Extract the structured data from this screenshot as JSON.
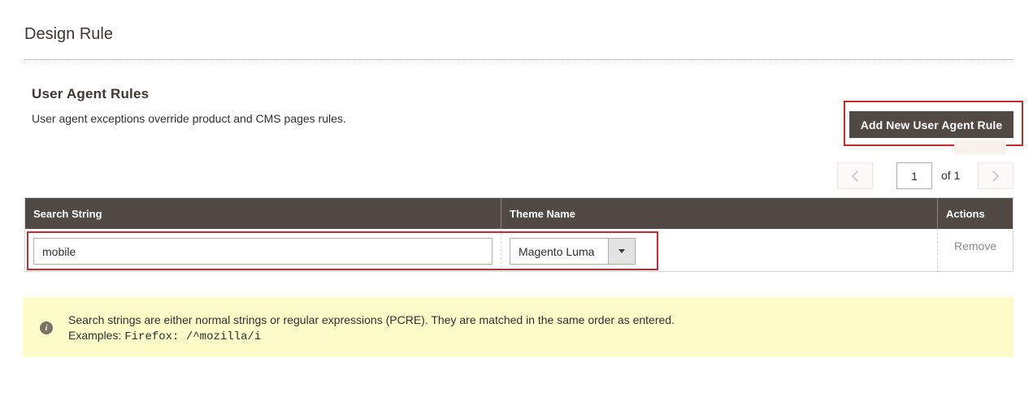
{
  "section": {
    "title": "Design Rule"
  },
  "user_agent_rules": {
    "title": "User Agent Rules",
    "description": "User agent exceptions override product and CMS pages rules.",
    "add_button_label": "Add New User Agent Rule"
  },
  "pager": {
    "prev_icon": "chevron-left-icon",
    "current_page": "1",
    "of_text": "of 1",
    "next_icon": "chevron-right-icon"
  },
  "grid": {
    "columns": [
      "Search String",
      "Theme Name",
      "Actions"
    ],
    "rows": [
      {
        "search_string": "mobile",
        "theme_name": "Magento Luma",
        "action": "Remove"
      }
    ]
  },
  "notice": {
    "icon": "info-icon",
    "line1": "Search strings are either normal strings or regular expressions (PCRE). They are matched in the same order as entered.",
    "examples_label": "Examples: ",
    "examples_code": "Firefox: /^mozilla/i"
  },
  "colors": {
    "header_bg": "#514943",
    "highlight_border": "#cc2a2a",
    "notice_bg": "#fdfbc8"
  }
}
